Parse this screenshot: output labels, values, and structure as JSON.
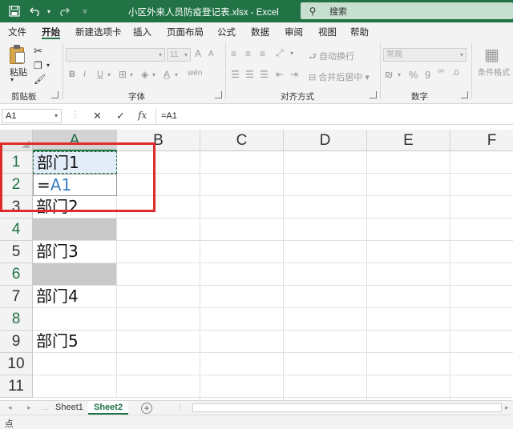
{
  "title_bar": {
    "title": "小区外来人员防疫登记表.xlsx  -  Excel",
    "search_placeholder": "搜索",
    "search_icon": "search-icon",
    "undo_icon": "undo-icon",
    "redo_icon": "redo-icon",
    "save_icon": "save-icon"
  },
  "menu": {
    "tabs": [
      "文件",
      "开始",
      "新建选项卡",
      "插入",
      "页面布局",
      "公式",
      "数据",
      "审阅",
      "视图",
      "帮助"
    ],
    "active": "开始"
  },
  "ribbon": {
    "clipboard": {
      "paste_label": "粘贴",
      "group_label": "剪贴板"
    },
    "font": {
      "font_size": "11",
      "group_label": "字体",
      "buttons": [
        "B",
        "I",
        "U",
        "A",
        "A"
      ]
    },
    "alignment": {
      "wrap_text": "自动换行",
      "merge_center": "合并后居中",
      "group_label": "对齐方式"
    },
    "number": {
      "format": "常规",
      "group_label": "数字",
      "symbols": [
        "%",
        "9"
      ]
    },
    "styles": {
      "conditional_format": "条件格式"
    }
  },
  "formula_bar": {
    "name_box": "A1",
    "fx_label": "fx",
    "formula": "=A1"
  },
  "grid": {
    "columns": [
      "A",
      "B",
      "C",
      "D",
      "E",
      "F"
    ],
    "rows": [
      "1",
      "2",
      "3",
      "4",
      "5",
      "6",
      "7",
      "8",
      "9",
      "10",
      "11"
    ],
    "cells": {
      "A1": "部门1",
      "A2_prefix": "=",
      "A2_ref": "A1",
      "A3": "部门2",
      "A5": "部门3",
      "A7": "部门4",
      "A9": "部门5"
    },
    "gray_rows": [
      "4",
      "6"
    ],
    "highlight_color": "#e02b2b"
  },
  "sheets": {
    "tabs": [
      "Sheet1",
      "Sheet2"
    ],
    "active": "Sheet2",
    "add_label": "+"
  },
  "status_bar": {
    "text": "点"
  },
  "colors": {
    "excel_green": "#217346",
    "reference_blue": "#3b7fc4"
  }
}
